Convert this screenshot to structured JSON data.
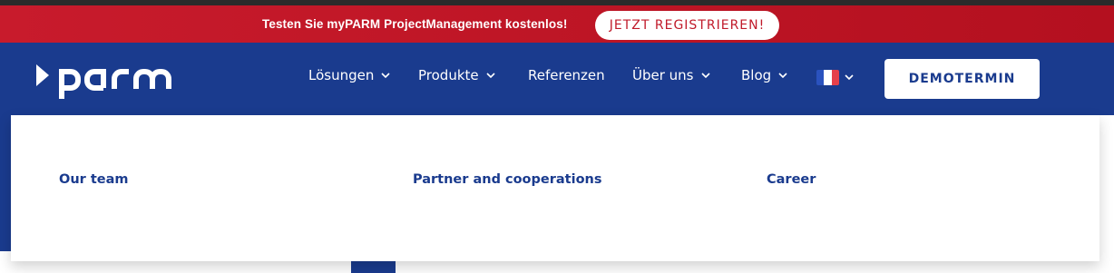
{
  "promo": {
    "text": "Testen Sie myPARM ProjectManagement kostenlos!",
    "button": "JETZT REGISTRIEREN!"
  },
  "nav": {
    "items": [
      {
        "label": "Lösungen",
        "dropdown": true
      },
      {
        "label": "Produkte",
        "dropdown": true
      },
      {
        "label": "Referenzen",
        "dropdown": false
      },
      {
        "label": "Über uns",
        "dropdown": true
      },
      {
        "label": "Blog",
        "dropdown": true
      }
    ],
    "language_flag": "french-flag-icon",
    "cta": "DEMOTERMIN"
  },
  "dropdown": {
    "links": [
      "Our team",
      "Partner and cooperations",
      "Career"
    ]
  },
  "colors": {
    "promo_red": "#c01a2a",
    "nav_blue": "#1a3b8e",
    "white": "#ffffff"
  }
}
